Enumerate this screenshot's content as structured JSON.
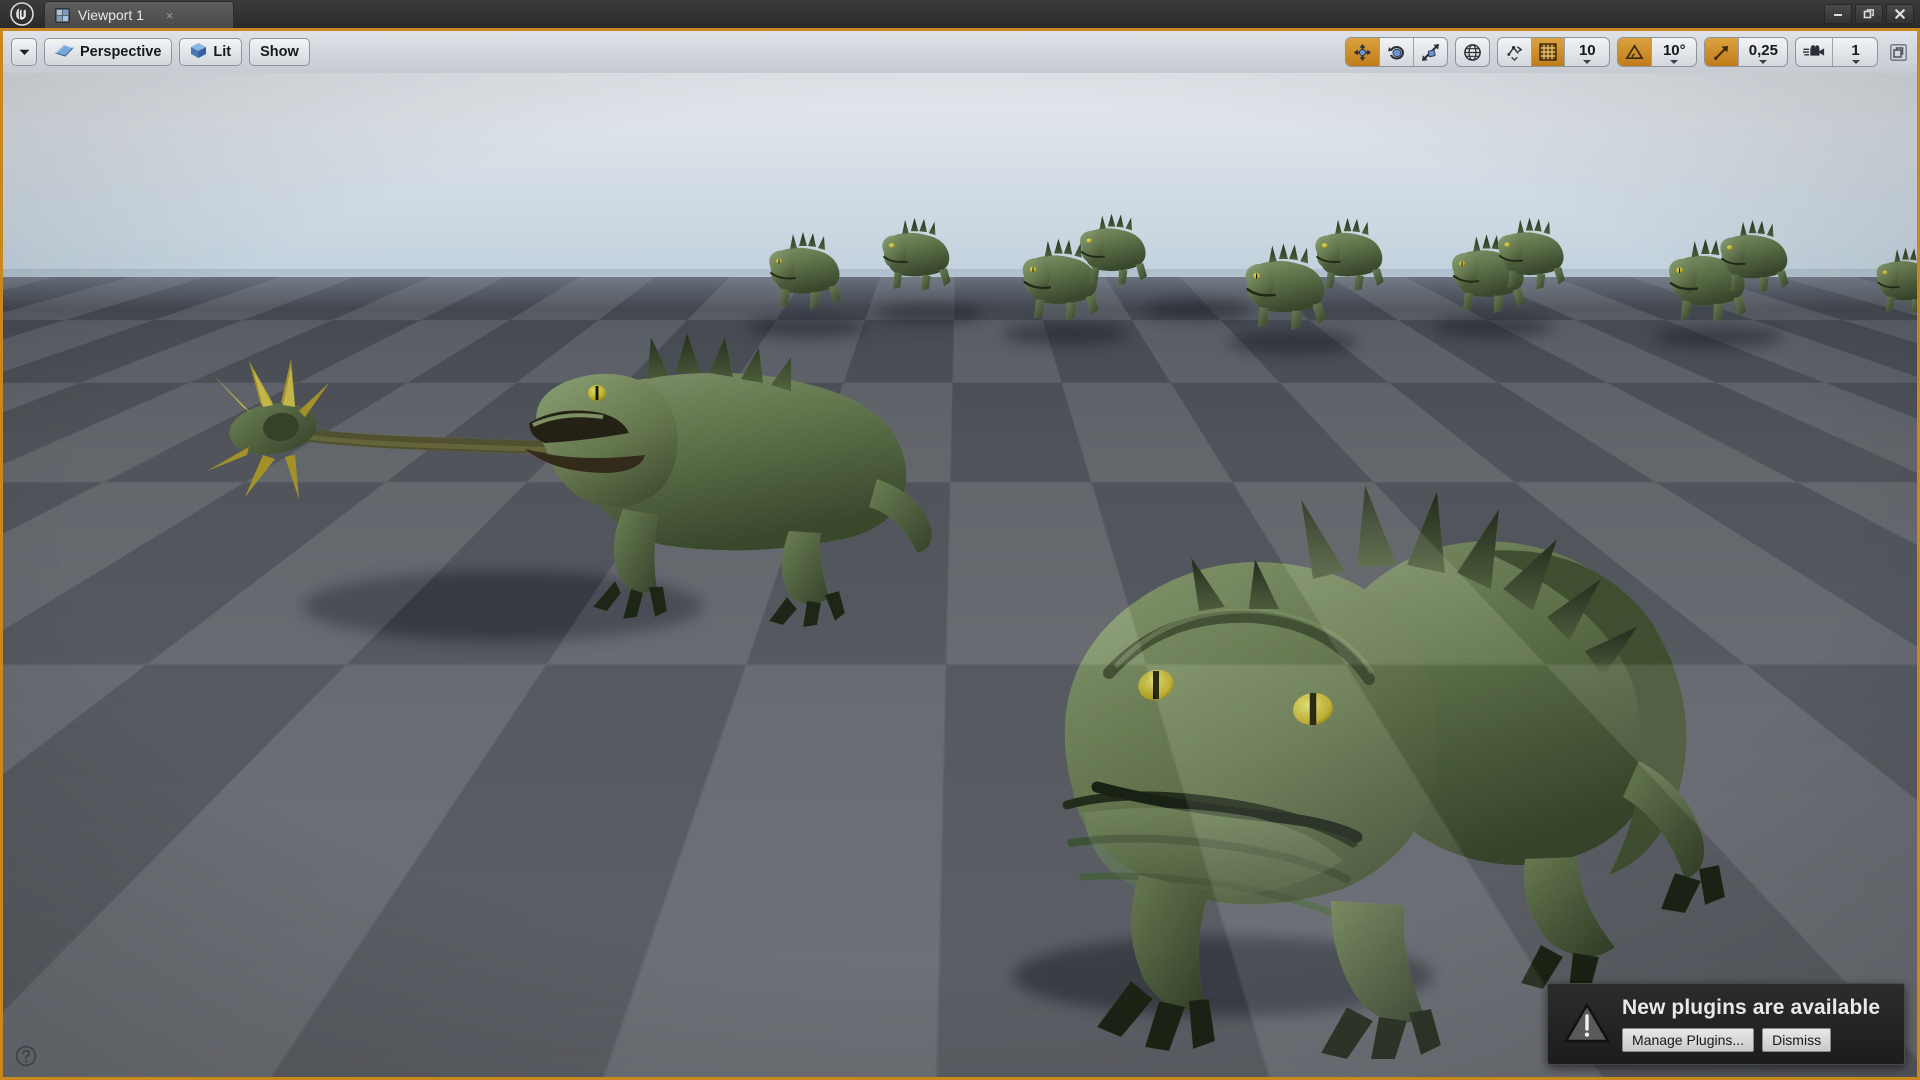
{
  "window": {
    "app": "unreal-engine",
    "logo_icon": "unreal-u-logo",
    "controls": [
      {
        "name": "minimize-button",
        "icon": "minimize-icon",
        "label": "Minimize"
      },
      {
        "name": "restore-button",
        "icon": "restore-icon",
        "label": "Restore"
      },
      {
        "name": "close-button",
        "icon": "close-icon",
        "label": "Close"
      }
    ]
  },
  "tab": {
    "icon": "viewport-grid-icon",
    "label": "Viewport 1",
    "close_label": "×"
  },
  "toolbar": {
    "left": {
      "menu_arrow_icon": "chevron-down-icon",
      "view_mode": {
        "label": "Perspective",
        "icon": "perspective-camera-icon"
      },
      "lighting_mode": {
        "label": "Lit",
        "icon": "lit-cube-icon"
      },
      "show_menu": {
        "label": "Show"
      }
    },
    "right": {
      "gizmos": [
        {
          "name": "translate-gizmo",
          "icon": "move-arrows-icon",
          "active": true
        },
        {
          "name": "rotate-gizmo",
          "icon": "rotate-icon",
          "active": false
        },
        {
          "name": "scale-gizmo",
          "icon": "scale-icon",
          "active": false
        }
      ],
      "coordinate_system": {
        "name": "world-coordinate-toggle",
        "icon": "globe-icon",
        "active": false
      },
      "surface_snap": {
        "name": "surface-snap-toggle",
        "icon": "surface-snap-icon",
        "active": false
      },
      "grid_snap": {
        "name": "grid-snap-toggle",
        "icon": "grid-icon",
        "active": true,
        "value": "10"
      },
      "rotation_snap": {
        "name": "rotation-snap-toggle",
        "icon": "angle-icon",
        "active": true,
        "value": "10°"
      },
      "scale_snap": {
        "name": "scale-snap-toggle",
        "icon": "scale-arrow-icon",
        "active": true,
        "value": "0,25"
      },
      "camera_speed": {
        "name": "camera-speed",
        "icon": "camera-icon",
        "value": "1"
      },
      "maximize_viewport": {
        "name": "maximize-viewport-button",
        "icon": "maximize-icon"
      }
    }
  },
  "viewport": {
    "border_color": "#c8881f",
    "sky_color": "#ccd8e2",
    "ground_color": "#5b5f66",
    "help_icon": "help-question-icon",
    "scene": {
      "description": "grey checkerboard plane with rows of green toad-like creatures",
      "creature_color": "#6f7a58",
      "creature_accent": "#3f8a3a",
      "eye_color": "#e8d24a",
      "foreground_creatures": 2,
      "background_creatures": 11
    }
  },
  "notification": {
    "icon": "warning-triangle-icon",
    "title": "New plugins are available",
    "buttons": [
      {
        "name": "manage-plugins-button",
        "label": "Manage Plugins..."
      },
      {
        "name": "dismiss-button",
        "label": "Dismiss"
      }
    ]
  }
}
